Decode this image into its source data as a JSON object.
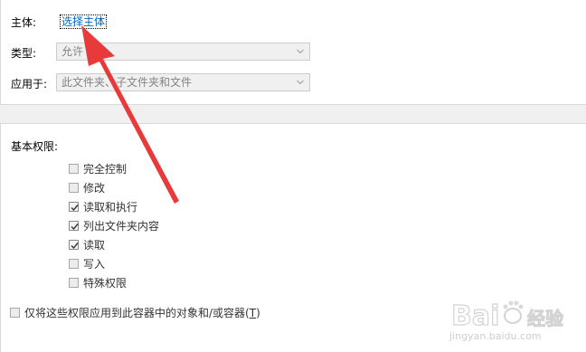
{
  "principal": {
    "label": "主体:",
    "link_text": "选择主体"
  },
  "type": {
    "label": "类型:",
    "value": "允许"
  },
  "applies_to": {
    "label": "应用于:",
    "value": "此文件夹、子文件夹和文件"
  },
  "basic_permissions": {
    "heading": "基本权限:",
    "items": [
      {
        "label": "完全控制",
        "checked": false
      },
      {
        "label": "修改",
        "checked": false
      },
      {
        "label": "读取和执行",
        "checked": true
      },
      {
        "label": "列出文件夹内容",
        "checked": true
      },
      {
        "label": "读取",
        "checked": true
      },
      {
        "label": "写入",
        "checked": false
      },
      {
        "label": "特殊权限",
        "checked": false
      }
    ]
  },
  "apply_only": {
    "label": "仅将这些权限应用到此容器中的对象和/或容器(",
    "accel": "T",
    "suffix": ")",
    "checked": false
  },
  "watermark": {
    "brand": "Bai",
    "brand2": "经验",
    "url": "jingyan.baidu.com"
  },
  "colors": {
    "link": "#0067c0",
    "arrow": "#e83a3a",
    "disabled_text": "#838383"
  }
}
